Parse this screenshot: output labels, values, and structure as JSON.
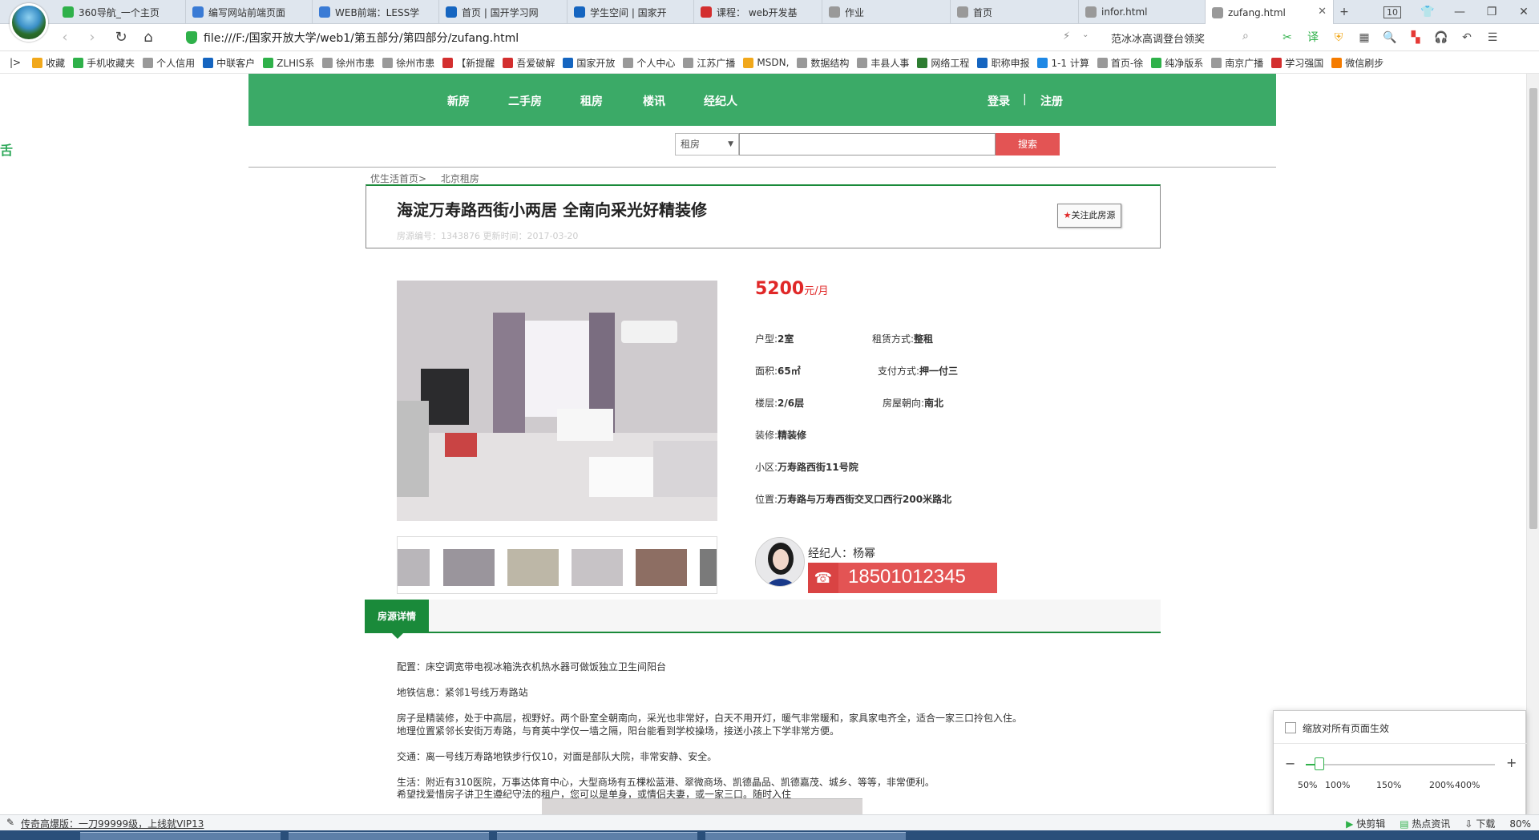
{
  "browser": {
    "tabs": [
      {
        "label": "360导航_一个主页",
        "color": "#2fb14a",
        "active": false
      },
      {
        "label": "编写网站前端页面",
        "color": "#3a7bd5",
        "active": false
      },
      {
        "label": "WEB前端：LESS学",
        "color": "#3a7bd5",
        "active": false
      },
      {
        "label": "首页 | 国开学习网",
        "color": "#1565c0",
        "active": false
      },
      {
        "label": "学生空间 | 国家开",
        "color": "#1565c0",
        "active": false
      },
      {
        "label": "课程： web开发基",
        "color": "#d32f2f",
        "active": false
      },
      {
        "label": "作业",
        "color": "#999999",
        "active": false
      },
      {
        "label": "首页",
        "color": "#999999",
        "active": false
      },
      {
        "label": "infor.html",
        "color": "#999999",
        "active": false
      },
      {
        "label": "zufang.html",
        "color": "#999999",
        "active": true
      }
    ],
    "tab_count": "10",
    "url": "file:///F:/国家开放大学/web1/第五部分/第四部分/zufang.html",
    "search_hint": "范冰冰高调登台领奖",
    "zoom": "80%",
    "bookmarks": [
      "收藏",
      "手机收藏夹",
      "个人信用",
      "中联客户",
      "ZLHIS系",
      "徐州市患",
      "徐州市患",
      "【新提醒",
      "吾爱破解",
      "国家开放",
      "个人中心",
      "江苏广播",
      "MSDN,",
      "数据结构",
      "丰县人事",
      "网络工程",
      "职称申报",
      "1-1 计算",
      "首页-徐",
      "纯净版系",
      "南京广播",
      "学习强国",
      "微信刷步"
    ]
  },
  "site": {
    "nav": [
      "新房",
      "二手房",
      "租房",
      "楼讯",
      "经纪人"
    ],
    "login": "登录",
    "separator": "|",
    "register": "注册",
    "search": {
      "select_value": "租房",
      "button": "搜索"
    },
    "breadcrumb": [
      "优生活首页>",
      "北京租房"
    ]
  },
  "listing": {
    "title": "海淀万寿路西街小两居 全南向采光好精装修",
    "meta": "房源编号：1343876  更新时间：2017-03-20",
    "follow_label": "关注此房源",
    "price": "5200",
    "price_unit": "元/月",
    "fields": [
      {
        "label": "户型:",
        "value": "2室"
      },
      {
        "label": "租赁方式:",
        "value": "整租"
      },
      {
        "label": "面积:",
        "value": "65㎡"
      },
      {
        "label": "支付方式:",
        "value": "押一付三"
      },
      {
        "label": "楼层:",
        "value": "2/6层"
      },
      {
        "label": "房屋朝向:",
        "value": "南北"
      },
      {
        "label": "装修:",
        "value": "精装修"
      },
      {
        "label": "小区:",
        "value": "万寿路西街11号院"
      },
      {
        "label": "位置:",
        "value": "万寿路与万寿西街交叉口西行200米路北"
      }
    ],
    "agent": {
      "label": "经纪人：",
      "name": "杨幂",
      "phone": "18501012345"
    }
  },
  "details": {
    "tab": "房源详情",
    "lines": [
      "配置：床空调宽带电视冰箱洗衣机热水器可做饭独立卫生间阳台",
      "地铁信息：紧邻1号线万寿路站",
      "房子是精装修，处于中高层，视野好。两个卧室全朝南向，采光也非常好，白天不用开灯，暖气非常暖和，家具家电齐全，适合一家三口拎包入住。",
      "地理位置紧邻长安街万寿路，与育英中学仅一墙之隔，阳台能看到学校操场，接送小孩上下学非常方便。",
      "交通：离一号线万寿路地铁步行仅10，对面是部队大院，非常安静、安全。",
      "生活：附近有310医院，万事达体育中心，大型商场有五棵松蓝港、翠微商场、凯德晶品、凯德嘉茂、城乡、等等，非常便利。",
      "希望找爱惜房子讲卫生遵纪守法的租户，您可以是单身，或情侣夫妻，或一家三口。随时入住"
    ]
  },
  "zoom_popup": {
    "checkbox_label": "缩放对所有页面生效",
    "ticks": [
      "50%",
      "100%",
      "150%",
      "200%",
      "400%"
    ],
    "value": 0.07
  },
  "statusbar": {
    "left": "传奇高爆版：一刀99999级，上线就VIP13",
    "right": [
      "快剪辑",
      "热点资讯",
      "下载"
    ],
    "zoom": "80%"
  }
}
